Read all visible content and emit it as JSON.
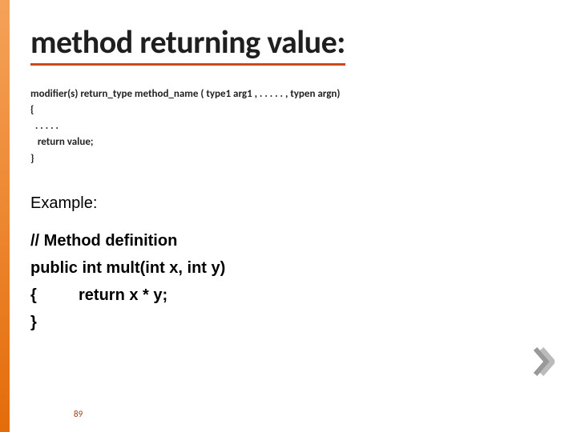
{
  "title": "method returning value:",
  "syntax": {
    "line1": "modifier(s)   return_type   method_name ( type1 arg1 ,  . . . . .  , typen argn)",
    "line2": "{",
    "line3": "  . . . . .",
    "line4": "   return value;",
    "line5": "}"
  },
  "example_heading": "Example:",
  "code": {
    "comment": "// Method definition",
    "signature": "public int mult(int x, int y)",
    "open_brace": "{",
    "body": "return x * y;",
    "close_brace": "}"
  },
  "slide_number": "89",
  "icons": {
    "chevron": "chevron-right-icon"
  }
}
